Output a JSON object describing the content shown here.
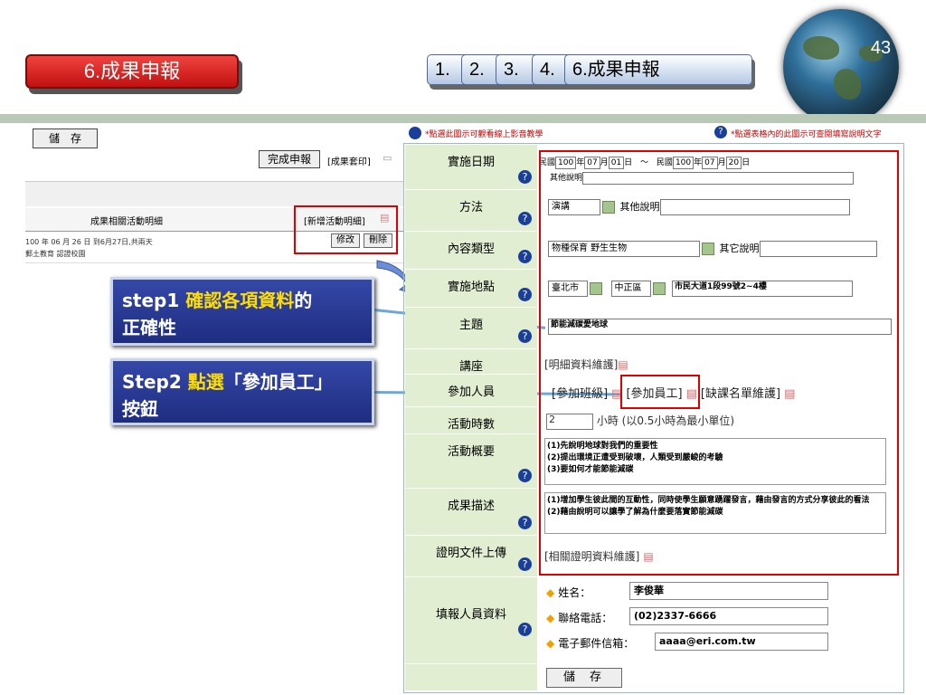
{
  "slide": {
    "title": "6.成果申報",
    "page_number": "43",
    "steps": [
      "1.",
      "2.",
      "3.",
      "4.",
      "6.成果申報"
    ]
  },
  "left_panel": {
    "save_label": "儲　存",
    "complete_label": "完成申報",
    "print_label": "[成果套印]",
    "activity_list_title": "成果相關活動明細",
    "add_activity_label": "[新增活動明細]",
    "edit_label": "修改",
    "delete_label": "刪除",
    "activity_date": "100 年 06 月 26 日 到6月27日,共兩天",
    "activity_location": "郵土教育 認證校園"
  },
  "callouts": {
    "step1_prefix": "step1 ",
    "step1_highlight": "確認各項資料",
    "step1_suffix": "的",
    "step1_line2": "正確性",
    "step2_prefix": "Step2 ",
    "step2_highlight": "點選",
    "step2_suffix": "「參加員工」",
    "step2_line2": "按鈕"
  },
  "form": {
    "video_tip": "*點選此圖示可觀看線上影音教學",
    "help_tip": "*點選表格內的此圖示可查閱填寫說明文字",
    "labels": {
      "date": "實施日期",
      "method": "方法",
      "content_type": "內容類型",
      "location": "實施地點",
      "topic": "主題",
      "lecture": "講座",
      "participants": "參加人員",
      "hours": "活動時數",
      "overview": "活動概要",
      "result": "成果描述",
      "upload": "證明文件上傳",
      "reporter": "填報人員資料"
    },
    "date": {
      "era1": "民國",
      "year1": "100",
      "y": "年",
      "month1": "07",
      "m": "月",
      "day1": "01",
      "d": "日",
      "tilde": "～",
      "era2": "民國",
      "year2": "100",
      "month2": "07",
      "day2": "20",
      "other_label": "其他說明"
    },
    "method": {
      "value": "演講",
      "other_label": "其他說明"
    },
    "content_type": {
      "value": "物種保育 野生生物",
      "other_label": "其它說明"
    },
    "location": {
      "city": "臺北市",
      "district": "中正區",
      "address": "市民大道1段99號2~4樓"
    },
    "topic": {
      "value": "節能減碳愛地球"
    },
    "lecture": {
      "link": "[明細資料維護]"
    },
    "participants": {
      "class_link": "[參加班級]",
      "staff_link": "[參加員工]",
      "absent_link": "[缺課名單維護]"
    },
    "hours": {
      "value": "2",
      "unit": "小時 (以0.5小時為最小單位)"
    },
    "overview": {
      "line1": "(1)先說明地球對我們的重要性",
      "line2": "(2)提出環境正遭受到破壞，人類受到嚴峻的考驗",
      "line3": "(3)要如何才能節能減碳"
    },
    "result": {
      "line1": "(1)增加學生彼此間的互動性，同時使學生願意踴躍發言，藉由發言的方式分享彼此的看法",
      "line2": "(2)藉由說明可以讓學了解為什麼要落實節能減碳"
    },
    "upload": {
      "link": "[相關證明資料維護]"
    },
    "reporter": {
      "name_label": "姓名：",
      "name": "李俊華",
      "phone_label": "聯絡電話：",
      "phone": "(02)2337-6666",
      "email_label": "電子郵件信箱：",
      "email": "aaaa@eri.com.tw"
    },
    "save_label": "儲存"
  }
}
